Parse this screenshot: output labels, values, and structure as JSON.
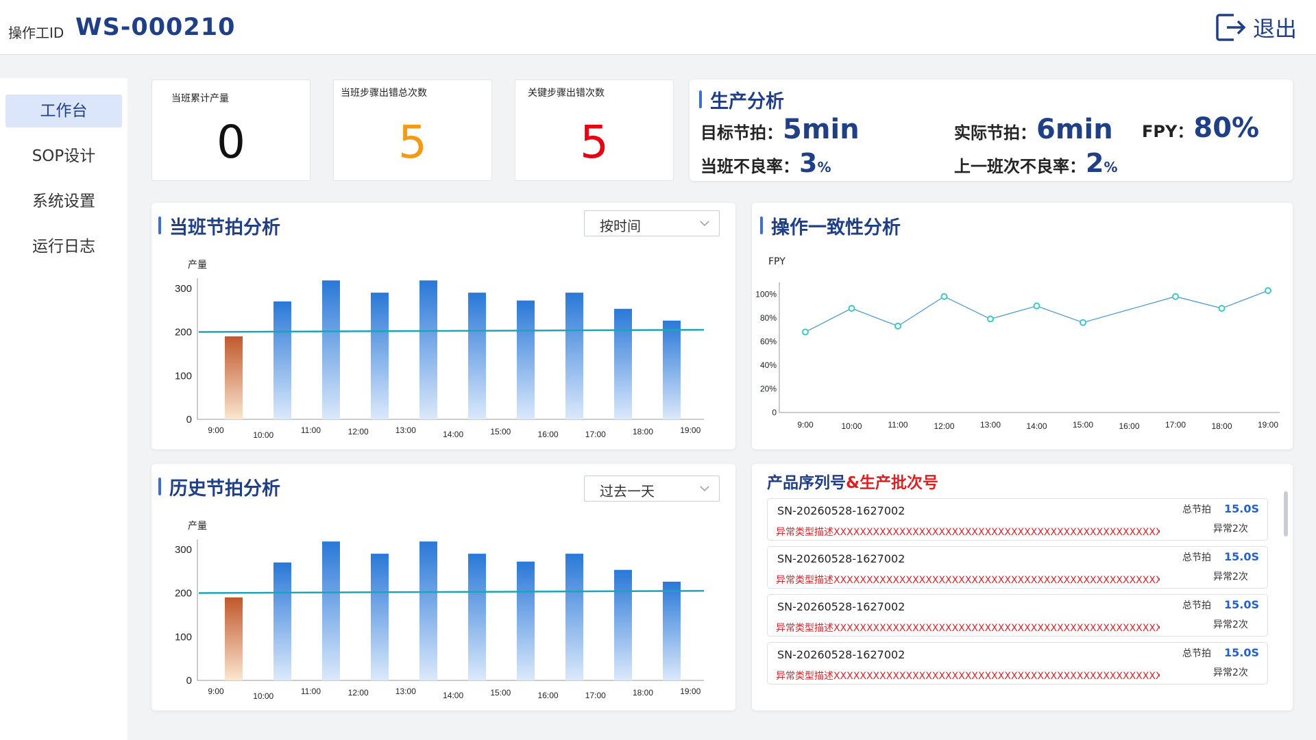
{
  "header": {
    "operator_label": "操作工ID",
    "operator_id": "WS-000210",
    "logout_label": "退出"
  },
  "sidebar": {
    "items": [
      {
        "label": "工作台",
        "active": true
      },
      {
        "label": "SOP设计",
        "active": false
      },
      {
        "label": "系统设置",
        "active": false
      },
      {
        "label": "运行日志",
        "active": false
      }
    ]
  },
  "stats": [
    {
      "label": "当班累计产量",
      "value": "0",
      "color": "#111111"
    },
    {
      "label": "当班步骤出错总次数",
      "value": "5",
      "color": "#f59a12"
    },
    {
      "label": "关键步骤出错次数",
      "value": "5",
      "color": "#e60012"
    }
  ],
  "production": {
    "title": "生产分析",
    "target_label": "目标节拍：",
    "target_value": "5min",
    "actual_label": "实际节拍：",
    "actual_value": "6min",
    "fpy_label": "FPY：",
    "fpy_value": "80%",
    "defect_label": "当班不良率：",
    "defect_value": "3",
    "defect_unit": "%",
    "prev_defect_label": "上一班次不良率：",
    "prev_defect_value": "2",
    "prev_defect_unit": "%"
  },
  "shift_chart": {
    "title": "当班节拍分析",
    "select_value": "按时间",
    "ylabel": "产量"
  },
  "history_chart": {
    "title": "历史节拍分析",
    "select_value": "过去一天",
    "ylabel": "产量"
  },
  "consistency_chart": {
    "title": "操作一致性分析",
    "ylabel": "FPY"
  },
  "serials": {
    "title_a": "产品序列号",
    "title_b": "&生产批次号",
    "zjp_label": "总节拍",
    "rows": [
      {
        "sn": "SN-20260528-1627002",
        "error": "异常类型描述XXXXXXXXXXXXXXXXXXXXXXXXXXXXXXXXXXXXXXXXXXXXXXXXXXX",
        "time": "15.0S",
        "abnormal": "异常2次"
      },
      {
        "sn": "SN-20260528-1627002",
        "error": "异常类型描述XXXXXXXXXXXXXXXXXXXXXXXXXXXXXXXXXXXXXXXXXXXXXXXXXXX",
        "time": "15.0S",
        "abnormal": "异常2次"
      },
      {
        "sn": "SN-20260528-1627002",
        "error": "异常类型描述XXXXXXXXXXXXXXXXXXXXXXXXXXXXXXXXXXXXXXXXXXXXXXXXXXX",
        "time": "15.0S",
        "abnormal": "异常2次"
      },
      {
        "sn": "SN-20260528-1627002",
        "error": "异常类型描述XXXXXXXXXXXXXXXXXXXXXXXXXXXXXXXXXXXXXXXXXXXXXXXXXXX",
        "time": "15.0S",
        "abnormal": "异常2次"
      }
    ]
  },
  "chart_data": [
    {
      "type": "bar",
      "ylabel": "产量",
      "categories": [
        "9:00",
        "10:00",
        "11:00",
        "12:00",
        "13:00",
        "14:00",
        "15:00",
        "16:00",
        "17:00",
        "18:00",
        "19:00"
      ],
      "values": [
        190,
        270,
        318,
        290,
        318,
        290,
        272,
        290,
        253,
        226
      ],
      "yticks": [
        0,
        100,
        200,
        300
      ],
      "ylim": [
        0,
        320
      ],
      "target_line": [
        200,
        205
      ],
      "highlight_first_bar": true,
      "colors": {
        "bar": "#2a78d8",
        "bar_low": "#b6328a",
        "first_bar": "#c1582c",
        "line": "#1ea4b8"
      }
    },
    {
      "type": "bar",
      "ylabel": "产量",
      "categories": [
        "9:00",
        "10:00",
        "11:00",
        "12:00",
        "13:00",
        "14:00",
        "15:00",
        "16:00",
        "17:00",
        "18:00",
        "19:00"
      ],
      "values": [
        190,
        270,
        318,
        290,
        318,
        290,
        272,
        290,
        253,
        226
      ],
      "yticks": [
        0,
        100,
        200,
        300
      ],
      "ylim": [
        0,
        320
      ],
      "target_line": [
        200,
        205
      ],
      "highlight_first_bar": true,
      "colors": {
        "bar": "#2a78d8",
        "first_bar": "#c1582c",
        "line": "#1ea4b8"
      }
    },
    {
      "type": "line",
      "ylabel": "FPY",
      "categories": [
        "9:00",
        "10:00",
        "11:00",
        "12:00",
        "13:00",
        "14:00",
        "15:00",
        "16:00",
        "17:00",
        "18:00",
        "19:00"
      ],
      "points": [
        {
          "x": "9:00",
          "y": 68
        },
        {
          "x": "10:00",
          "y": 88
        },
        {
          "x": "11:00",
          "y": 73
        },
        {
          "x": "12:00",
          "y": 98
        },
        {
          "x": "13:00",
          "y": 79
        },
        {
          "x": "14:00",
          "y": 90
        },
        {
          "x": "15:00",
          "y": 76
        },
        {
          "x": "17:00",
          "y": 98
        },
        {
          "x": "18:00",
          "y": 88
        },
        {
          "x": "19:00",
          "y": 103
        }
      ],
      "yticks": [
        "0",
        "20%",
        "40%",
        "60%",
        "80%",
        "100%"
      ],
      "ylim": [
        0,
        110
      ],
      "colors": {
        "line": "#4f9ad8",
        "marker": "#3cc8c8"
      }
    }
  ]
}
